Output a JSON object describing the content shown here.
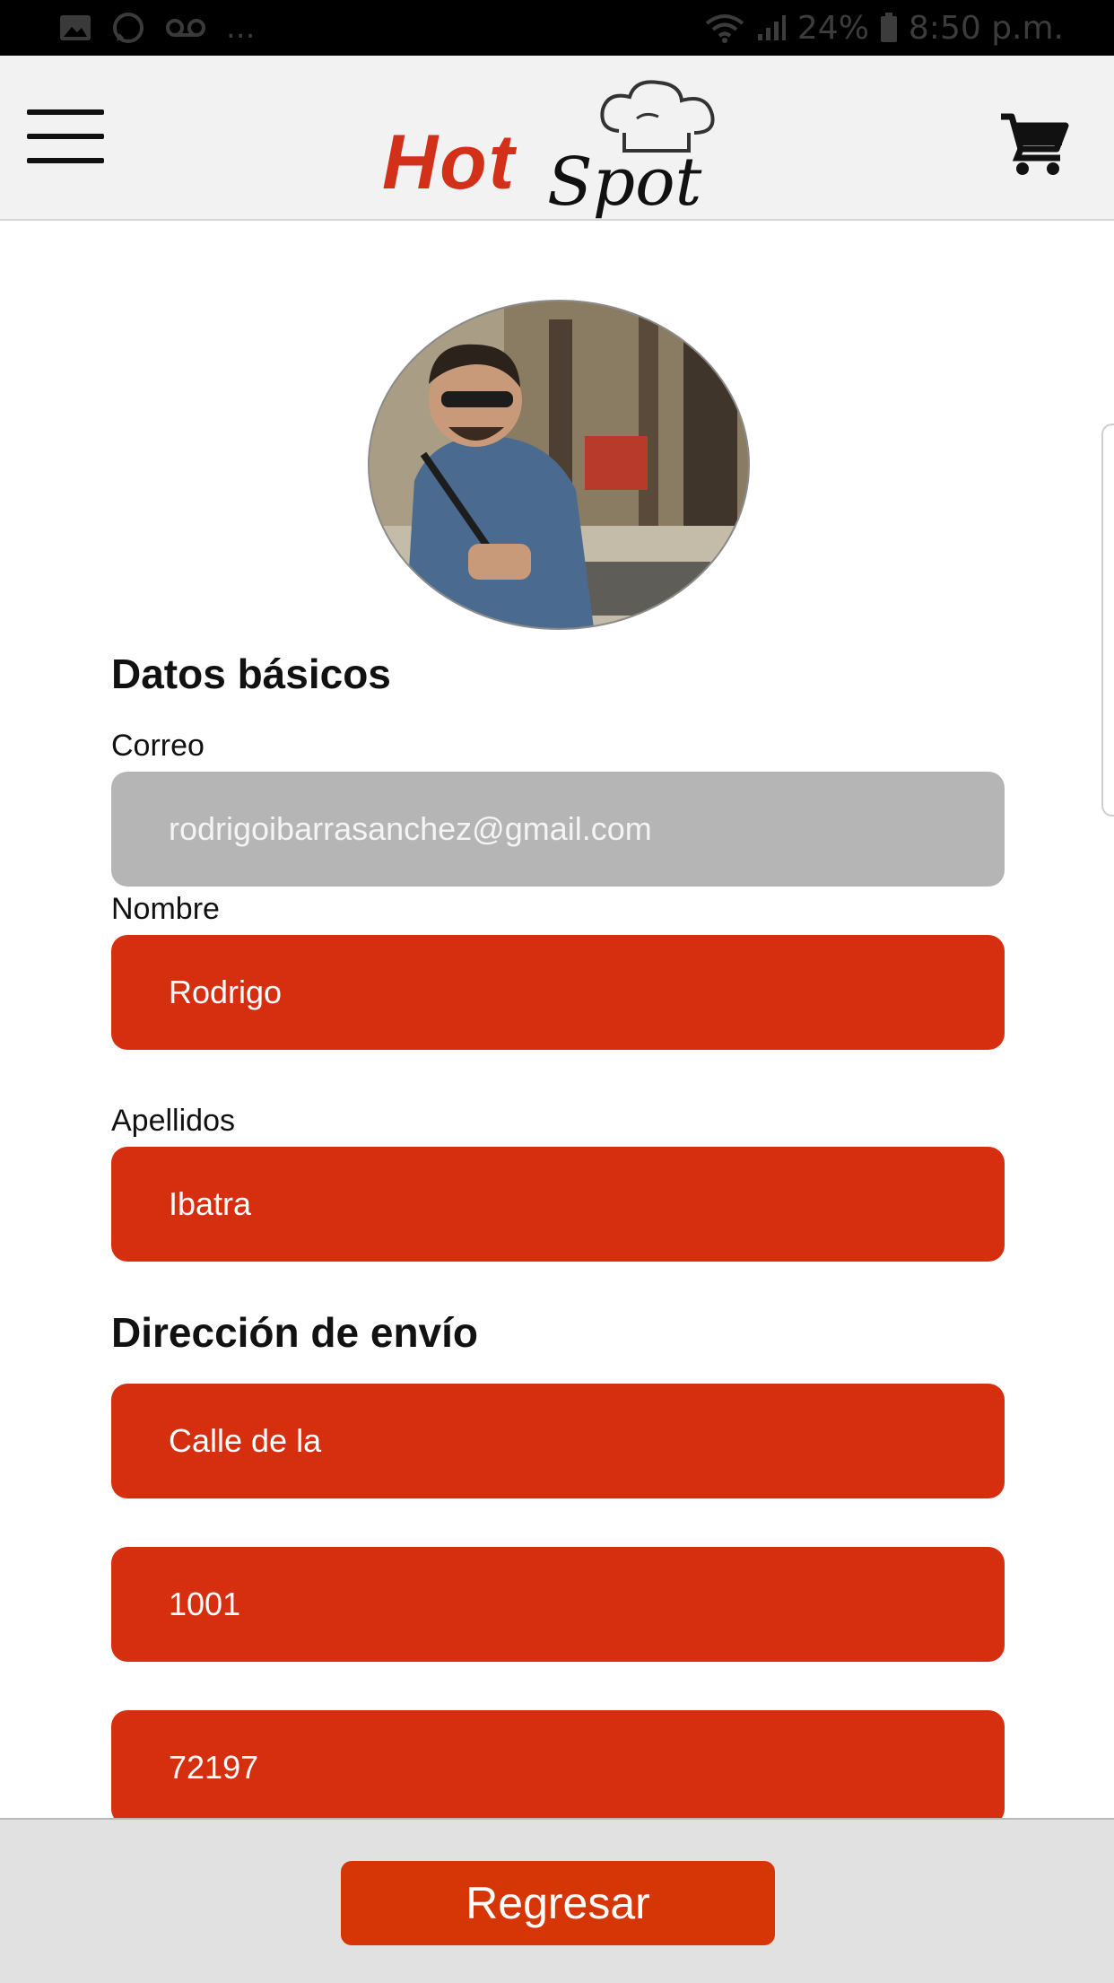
{
  "status_bar": {
    "notification_dots": "...",
    "battery_percent": "24%",
    "time": "8:50 p.m."
  },
  "header": {
    "logo_hot": "Hot",
    "logo_spot": "Spot",
    "menu_icon": "hamburger-icon",
    "cart_icon": "cart-icon"
  },
  "profile": {
    "avatar": "profile-photo"
  },
  "basic_data": {
    "title": "Datos básicos",
    "email_label": "Correo",
    "email_value": "rodrigoibarrasanchez@gmail.com",
    "name_label": "Nombre",
    "name_value": "Rodrigo",
    "lastname_label": "Apellidos",
    "lastname_value": "Ibatra"
  },
  "shipping": {
    "title": "Dirección de envío",
    "street_value": "Calle de la",
    "number_value": "1001",
    "zip_value": "72197"
  },
  "footer": {
    "back_label": "Regresar"
  },
  "colors": {
    "brand_red": "#d52f10",
    "disabled_field": "#b5b5b5",
    "button": "#d63505"
  }
}
